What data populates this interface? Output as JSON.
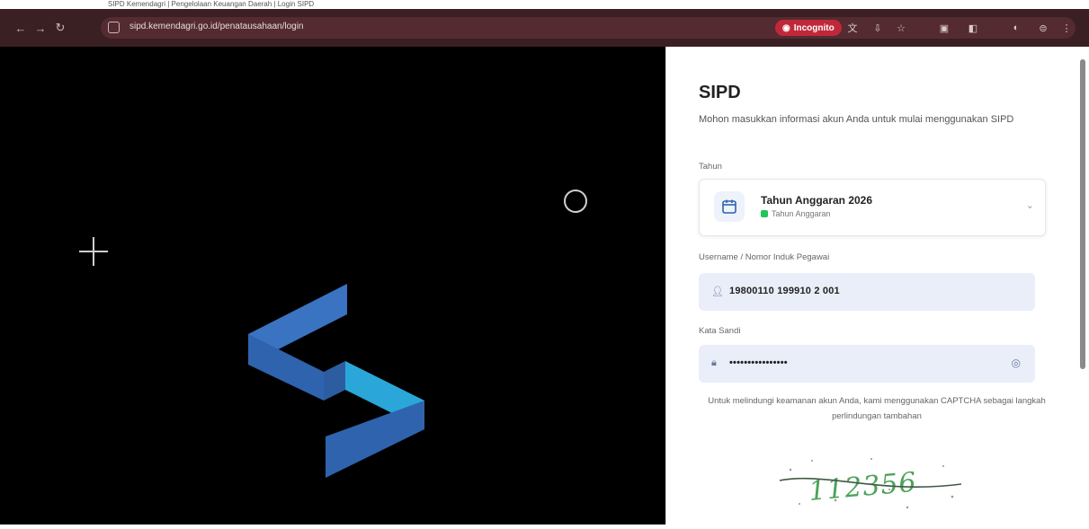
{
  "browser": {
    "tab_strip_text": "SIPD Kemendagri | Pengelolaan Keuangan Daerah | Login SIPD",
    "url": "sipd.kemendagri.go.id/penatausahaan/login",
    "incognito_label": "Incognito"
  },
  "login": {
    "title": "SIPD",
    "subtitle": "Mohon masukkan informasi akun Anda untuk mulai menggunakan SIPD",
    "year_label": "Tahun",
    "year_title": "Tahun Anggaran 2026",
    "year_sub": "Tahun Anggaran",
    "username_label": "Username / Nomor Induk Pegawai",
    "username_value": "19800110 199910 2 001",
    "password_label": "Kata Sandi",
    "password_value": "••••••••••••••••",
    "captcha_note": "Untuk melindungi keamanan akun Anda, kami menggunakan CAPTCHA sebagai langkah perlindungan tambahan",
    "captcha_text": "112356"
  },
  "colors": {
    "logo_dark": "#2f63ad",
    "logo_mid": "#3d7fd0",
    "logo_cyan": "#2aa7d8",
    "captcha_green": "#4ca35a"
  }
}
